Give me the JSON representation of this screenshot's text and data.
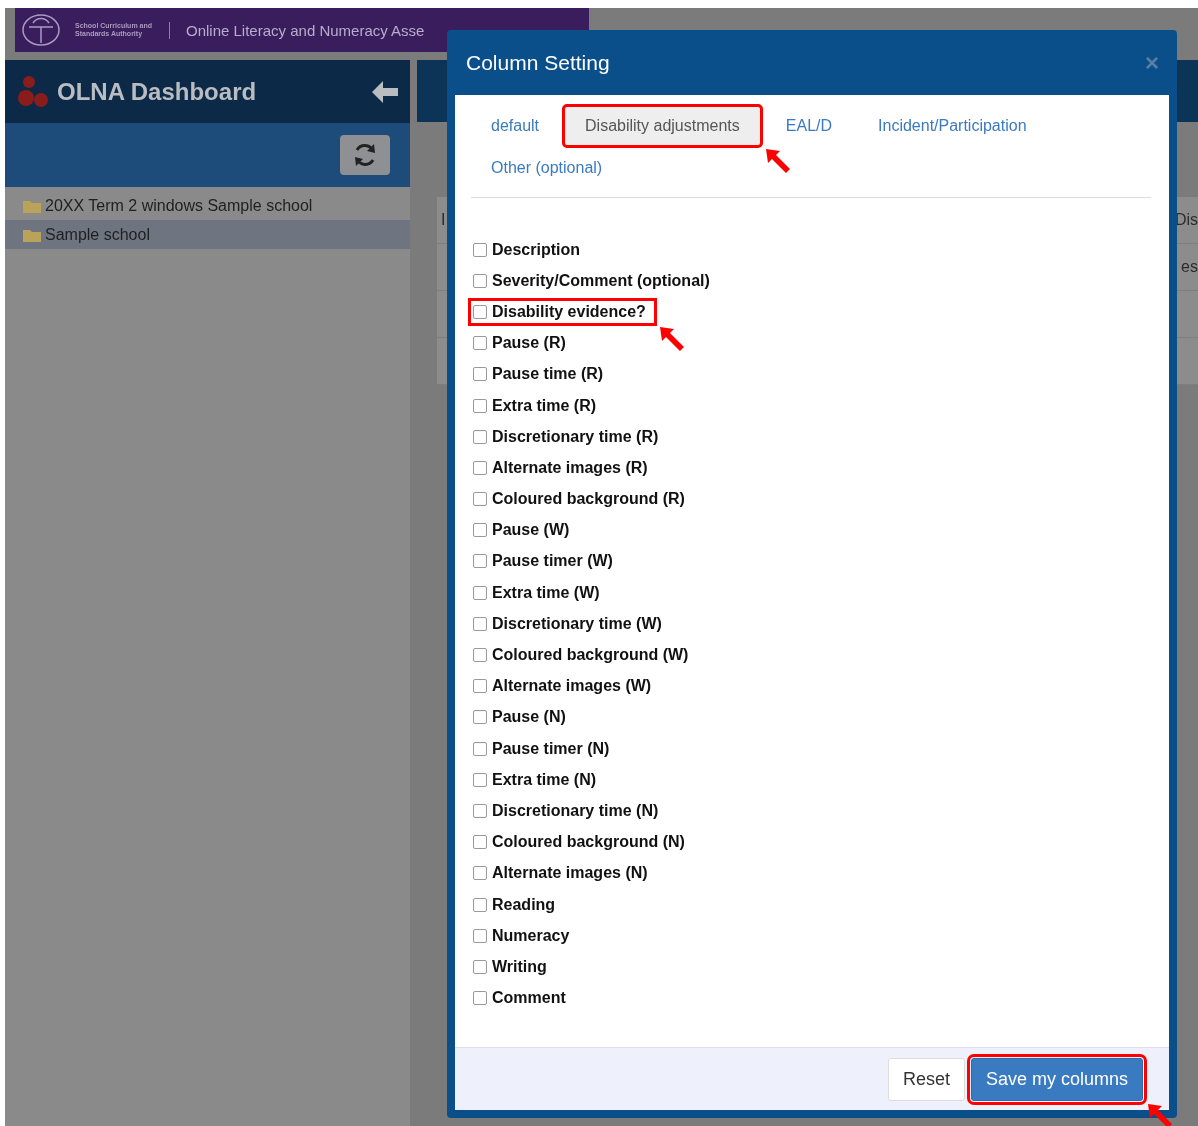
{
  "banner": {
    "org": "School Curriculum and Standards Authority",
    "title": "Online Literacy and Numeracy Asse"
  },
  "sidebar": {
    "title": "OLNA Dashboard",
    "tree": [
      {
        "label": "20XX Term 2 windows Sample school",
        "selected": false
      },
      {
        "label": "Sample school",
        "selected": true
      }
    ]
  },
  "background_table": {
    "rows": [
      {
        "column_1": "I",
        "column_2": "Dis"
      },
      {
        "column_2": "es"
      },
      {},
      {}
    ]
  },
  "dialog": {
    "title": "Column Setting",
    "close": "×",
    "tabs": [
      {
        "label": "default",
        "selected": false,
        "highlighted": false
      },
      {
        "label": "Disability adjustments",
        "selected": true,
        "highlighted": true
      },
      {
        "label": "EAL/D",
        "selected": false,
        "highlighted": false
      },
      {
        "label": "Incident/Participation",
        "selected": false,
        "highlighted": false
      },
      {
        "label": "Other (optional)",
        "selected": false,
        "highlighted": false
      }
    ],
    "columns": [
      {
        "label": "Description",
        "checked": false,
        "highlighted": false
      },
      {
        "label": "Severity/Comment (optional)",
        "checked": false,
        "highlighted": false
      },
      {
        "label": "Disability evidence?",
        "checked": false,
        "highlighted": true
      },
      {
        "label": "Pause (R)",
        "checked": false,
        "highlighted": false
      },
      {
        "label": "Pause time (R)",
        "checked": false,
        "highlighted": false
      },
      {
        "label": "Extra time (R)",
        "checked": false,
        "highlighted": false
      },
      {
        "label": "Discretionary time (R)",
        "checked": false,
        "highlighted": false
      },
      {
        "label": "Alternate images (R)",
        "checked": false,
        "highlighted": false
      },
      {
        "label": "Coloured background (R)",
        "checked": false,
        "highlighted": false
      },
      {
        "label": "Pause (W)",
        "checked": false,
        "highlighted": false
      },
      {
        "label": "Pause timer (W)",
        "checked": false,
        "highlighted": false
      },
      {
        "label": "Extra time (W)",
        "checked": false,
        "highlighted": false
      },
      {
        "label": "Discretionary time (W)",
        "checked": false,
        "highlighted": false
      },
      {
        "label": "Coloured background (W)",
        "checked": false,
        "highlighted": false
      },
      {
        "label": "Alternate images (W)",
        "checked": false,
        "highlighted": false
      },
      {
        "label": "Pause (N)",
        "checked": false,
        "highlighted": false
      },
      {
        "label": "Pause timer (N)",
        "checked": false,
        "highlighted": false
      },
      {
        "label": "Extra time (N)",
        "checked": false,
        "highlighted": false
      },
      {
        "label": "Discretionary time (N)",
        "checked": false,
        "highlighted": false
      },
      {
        "label": "Coloured background (N)",
        "checked": false,
        "highlighted": false
      },
      {
        "label": "Alternate images (N)",
        "checked": false,
        "highlighted": false
      },
      {
        "label": "Reading",
        "checked": false,
        "highlighted": false
      },
      {
        "label": "Numeracy",
        "checked": false,
        "highlighted": false
      },
      {
        "label": "Writing",
        "checked": false,
        "highlighted": false
      },
      {
        "label": "Comment",
        "checked": false,
        "highlighted": false
      }
    ],
    "buttons": [
      {
        "label": "Reset",
        "kind": "secondary",
        "highlighted": false
      },
      {
        "label": "Save my columns",
        "kind": "primary",
        "highlighted": true
      }
    ]
  }
}
